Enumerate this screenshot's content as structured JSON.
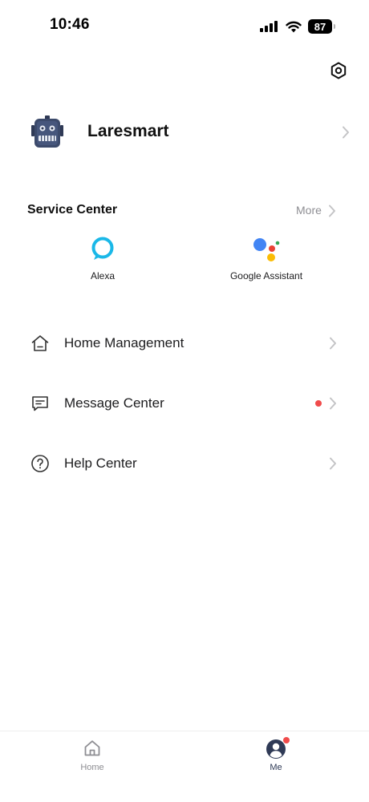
{
  "status_bar": {
    "time": "10:46",
    "battery": "87"
  },
  "profile": {
    "name": "Laresmart"
  },
  "service_center": {
    "title": "Service Center",
    "more_label": "More",
    "items": [
      {
        "label": "Alexa",
        "icon": "alexa-icon",
        "color": "#1ab8e8"
      },
      {
        "label": "Google Assistant",
        "icon": "google-assistant-icon",
        "colors": [
          "#4285f4",
          "#ea4335",
          "#fbbc05",
          "#34a853"
        ]
      }
    ]
  },
  "menu": [
    {
      "label": "Home Management",
      "icon": "home-icon",
      "has_badge": false
    },
    {
      "label": "Message Center",
      "icon": "message-icon",
      "has_badge": true
    },
    {
      "label": "Help Center",
      "icon": "help-icon",
      "has_badge": false
    }
  ],
  "tab_bar": {
    "tabs": [
      {
        "label": "Home",
        "icon": "home-tab-icon",
        "active": false
      },
      {
        "label": "Me",
        "icon": "profile-tab-icon",
        "active": true
      }
    ]
  },
  "colors": {
    "text_primary": "#1c1c1e",
    "text_secondary": "#8e8e93",
    "chevron": "#c4c4c6",
    "badge": "#f04b4b",
    "tab_active": "#2f3a56",
    "tab_inactive": "#8e8e93"
  }
}
